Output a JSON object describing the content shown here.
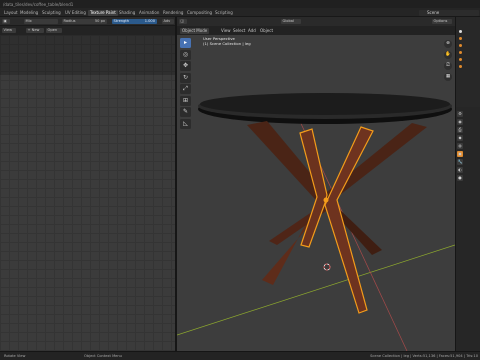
{
  "window": {
    "title": "/data_tiles/dev/coffee_table/blend1"
  },
  "workspaces": [
    "Layout",
    "Modeling",
    "Sculpting",
    "UV Editing",
    "Texture Paint",
    "Shading",
    "Animation",
    "Rendering",
    "Compositing",
    "Scripting"
  ],
  "active_workspace": "Texture Paint",
  "scene": {
    "name": "Scene"
  },
  "image_editor": {
    "mode": "Mix",
    "radius_label": "Radius",
    "radius_value": "50 px",
    "strength_label": "Strength",
    "strength_value": "1.000",
    "adv_label": "Adv",
    "view_label": "View",
    "image_new": "+ New",
    "image_open": "Open"
  },
  "viewport": {
    "mode": "Object Mode",
    "menus": [
      "View",
      "Select",
      "Add",
      "Object"
    ],
    "perspective": "User Perspective",
    "collection": "(1) Scene Collection | leg",
    "transform": "Global",
    "options": "Options"
  },
  "tools": [
    {
      "icon": "select-box-icon",
      "glyph": "▸",
      "active": true
    },
    {
      "icon": "cursor-icon",
      "glyph": "◎",
      "active": false
    },
    {
      "icon": "move-icon",
      "glyph": "✥",
      "active": false
    },
    {
      "icon": "rotate-icon",
      "glyph": "↻",
      "active": false
    },
    {
      "icon": "scale-icon",
      "glyph": "⤢",
      "active": false
    },
    {
      "icon": "transform-icon",
      "glyph": "⊞",
      "active": false
    },
    {
      "icon": "annotate-icon",
      "glyph": "✎",
      "active": false
    },
    {
      "icon": "measure-icon",
      "glyph": "◺",
      "active": false
    }
  ],
  "status": {
    "left": "Rotate View",
    "middle": "Object Context Menu",
    "right": "Scene Collection | leg | Verts:51,136 | Faces:51,904 | Tris:10"
  },
  "colors": {
    "accent": "#4772b3",
    "selection_outline": "#f39c1a",
    "table_top": "#1a1a1a",
    "wood": "#5a2a1a"
  }
}
